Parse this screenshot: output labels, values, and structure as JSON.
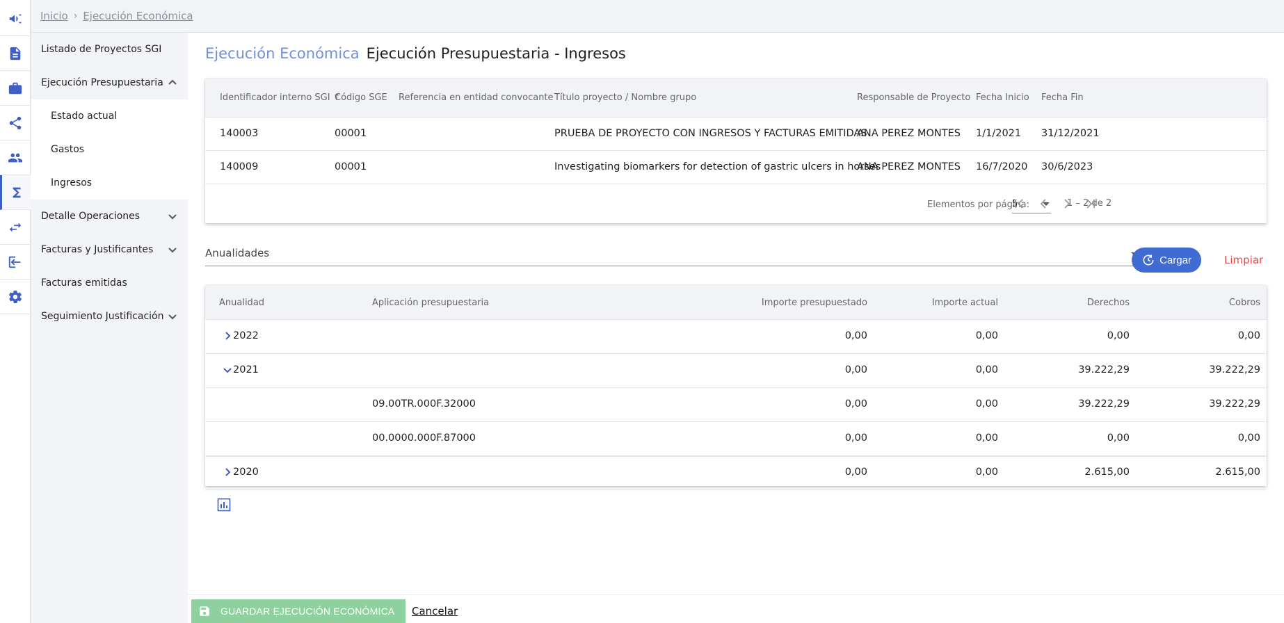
{
  "rail": {
    "items": [
      "megaphone-icon",
      "document-icon",
      "briefcase-icon",
      "share-icon",
      "group-icon",
      "sigma-icon",
      "transfer-icon",
      "logout-icon",
      "gear-icon"
    ],
    "active_index": 5,
    "color": "#3f5fc4"
  },
  "breadcrumb": {
    "home": "Inicio",
    "current": "Ejecución Económica"
  },
  "sidebar": {
    "items": [
      {
        "label": "Listado de Proyectos SGI"
      },
      {
        "label": "Ejecución Presupuestaria"
      },
      {
        "label": "Estado actual"
      },
      {
        "label": "Gastos"
      },
      {
        "label": "Ingresos"
      },
      {
        "label": "Detalle Operaciones"
      },
      {
        "label": "Facturas y Justificantes"
      },
      {
        "label": "Facturas emitidas"
      },
      {
        "label": "Seguimiento Justificación"
      }
    ]
  },
  "page": {
    "section": "Ejecución Económica",
    "title": "Ejecución Presupuestaria - Ingresos"
  },
  "projects": {
    "columns": [
      "Identificador interno SGI",
      "Código SGE",
      "Referencia en entidad convocante",
      "Título proyecto / Nombre grupo",
      "Responsable de Proyecto",
      "Fecha Inicio",
      "Fecha Fin"
    ],
    "sort_icon": "arrow-up-icon",
    "rows": [
      {
        "id": "140003",
        "sge": "00001",
        "ref": "",
        "title": "PRUEBA DE PROYECTO CON INGRESOS Y FACTURAS EMITIDAS",
        "responsable": "ANA PEREZ MONTES",
        "inicio": "1/1/2021",
        "fin": "31/12/2021"
      },
      {
        "id": "140009",
        "sge": "00001",
        "ref": "",
        "title": "Investigating biomarkers for detection of gastric ulcers in horses",
        "responsable": "ANA PEREZ MONTES",
        "inicio": "16/7/2020",
        "fin": "30/6/2023"
      }
    ],
    "paginator": {
      "label": "Elementos por página:",
      "page_size": "5",
      "range": "1 – 2 de 2"
    }
  },
  "filter": {
    "anualidades_label": "Anualidades",
    "cargar": "Cargar",
    "limpiar": "Limpiar"
  },
  "ingresos": {
    "columns": [
      "Anualidad",
      "Aplicación presupuestaria",
      "Importe presupuestado",
      "Importe actual",
      "Derechos",
      "Cobros"
    ],
    "rows": [
      {
        "anualidad": "2022",
        "aplicacion": "",
        "presupuestado": "0,00",
        "actual": "0,00",
        "derechos": "0,00",
        "cobros": "0,00",
        "state": "collapsed"
      },
      {
        "anualidad": "2021",
        "aplicacion": "",
        "presupuestado": "0,00",
        "actual": "0,00",
        "derechos": "39.222,29",
        "cobros": "39.222,29",
        "state": "expanded"
      },
      {
        "anualidad": "",
        "aplicacion": "09.00TR.000F.32000",
        "presupuestado": "0,00",
        "actual": "0,00",
        "derechos": "39.222,29",
        "cobros": "39.222,29",
        "state": "child"
      },
      {
        "anualidad": "",
        "aplicacion": "00.0000.000F.87000",
        "presupuestado": "0,00",
        "actual": "0,00",
        "derechos": "0,00",
        "cobros": "0,00",
        "state": "child"
      },
      {
        "anualidad": "2020",
        "aplicacion": "",
        "presupuestado": "0,00",
        "actual": "0,00",
        "derechos": "2.615,00",
        "cobros": "2.615,00",
        "state": "collapsed"
      }
    ],
    "chart_icon": "bar-chart-icon"
  },
  "footer": {
    "save": "GUARDAR EJECUCIÓN ECONÓMICA",
    "cancel": "Cancelar"
  },
  "colors": {
    "accent": "#3f6bd2",
    "title_accent": "#6e8fe0",
    "danger": "#e04b4b",
    "save_bg": "#8fd19e"
  }
}
